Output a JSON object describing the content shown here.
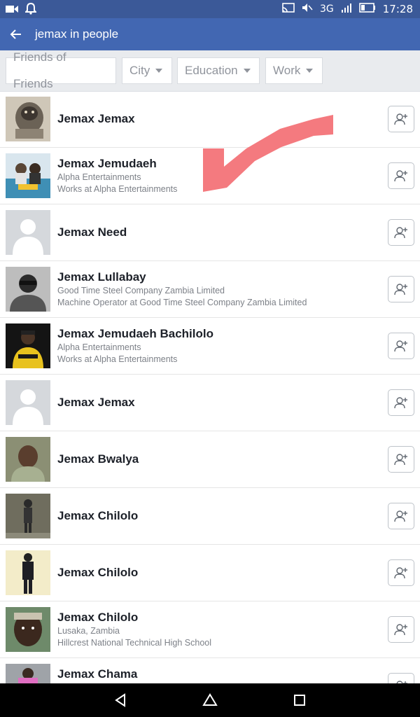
{
  "status_bar": {
    "network": "3G",
    "network_small": "3G",
    "time": "17:28",
    "icons": [
      "video-icon",
      "bell-icon",
      "cast-icon",
      "mute-icon",
      "signal-icon",
      "battery-icon"
    ]
  },
  "header": {
    "title": "jemax in people",
    "back_icon": "arrow-left-icon"
  },
  "filters": [
    {
      "label": "Friends of Friends",
      "dropdown": false
    },
    {
      "label": "City",
      "dropdown": true
    },
    {
      "label": "Education",
      "dropdown": true
    },
    {
      "label": "Work",
      "dropdown": true
    }
  ],
  "people": [
    {
      "name": "Jemax Jemax",
      "line1": "",
      "line2": "",
      "avatar": "wolf-photo"
    },
    {
      "name": "Jemax Jemudaeh",
      "line1": "Alpha Entertainments",
      "line2": "Works at Alpha Entertainments",
      "avatar": "album-art"
    },
    {
      "name": "Jemax Need",
      "line1": "",
      "line2": "",
      "avatar": "default-silhouette"
    },
    {
      "name": "Jemax Lullabay",
      "line1": "Good Time Steel Company Zambia Limited",
      "line2": "Machine Operator at Good Time Steel Company Zambia Limited",
      "avatar": "bw-portrait"
    },
    {
      "name": "Jemax Jemudaeh Bachilolo",
      "line1": "Alpha Entertainments",
      "line2": "Works at Alpha Entertainments",
      "avatar": "dark-portrait"
    },
    {
      "name": "Jemax Jemax",
      "line1": "",
      "line2": "",
      "avatar": "default-silhouette"
    },
    {
      "name": "Jemax Bwalya",
      "line1": "",
      "line2": "",
      "avatar": "face-photo"
    },
    {
      "name": "Jemax Chilolo",
      "line1": "",
      "line2": "",
      "avatar": "standing-photo"
    },
    {
      "name": "Jemax Chilolo",
      "line1": "",
      "line2": "",
      "avatar": "suit-photo"
    },
    {
      "name": "Jemax Chilolo",
      "line1": "Lusaka, Zambia",
      "line2": "Hillcrest National Technical High School",
      "avatar": "close-face-photo"
    },
    {
      "name": "Jemax Chama",
      "line1": "",
      "line2": "",
      "avatar": "pink-photo"
    }
  ],
  "colors": {
    "brand_blue": "#4267b2",
    "status_blue": "#3b5998",
    "annotation_red": "#f47a7f"
  },
  "nav_icons": [
    "back-triangle-icon",
    "home-icon",
    "recents-square-icon"
  ]
}
